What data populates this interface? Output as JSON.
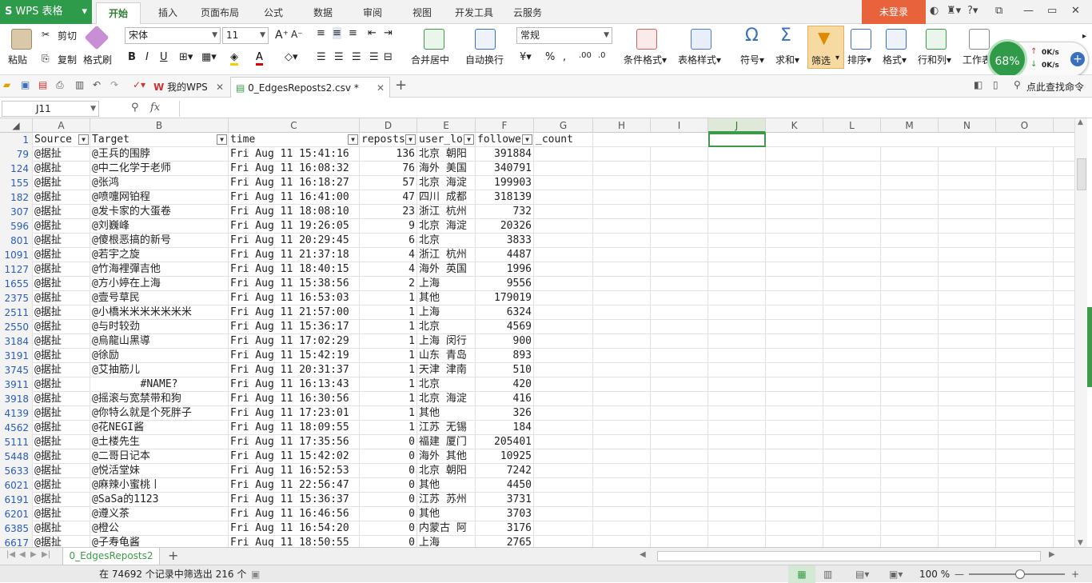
{
  "app": {
    "name": "WPS 表格"
  },
  "menu_tabs": [
    "开始",
    "插入",
    "页面布局",
    "公式",
    "数据",
    "审阅",
    "视图",
    "开发工具",
    "云服务"
  ],
  "login": "未登录",
  "ribbon": {
    "paste": "粘贴",
    "cut": "剪切",
    "copy": "复制",
    "format_painter": "格式刷",
    "font_name": "宋体",
    "font_size": "11",
    "merge": "合并居中",
    "wrap": "自动换行",
    "number_format": "常规",
    "cond_format": "条件格式",
    "table_style": "表格样式",
    "symbol": "符号",
    "sum": "求和",
    "filter": "筛选",
    "sort": "排序",
    "format": "格式",
    "rowcol": "行和列",
    "worksheet": "工作表"
  },
  "net_widget": {
    "percent": "68%",
    "up": "0K/s",
    "down": "0K/s"
  },
  "doc_tabs": {
    "mywps": "我的WPS",
    "file": "0_EdgesReposts2.csv *",
    "find_cmd": "点此查找命令"
  },
  "formula": {
    "cell_ref": "J11",
    "fx": "fx",
    "content": ""
  },
  "columns": [
    "A",
    "B",
    "C",
    "D",
    "E",
    "F",
    "G",
    "H",
    "I",
    "J",
    "K",
    "L",
    "M",
    "N",
    "O"
  ],
  "header_row": {
    "num": "1",
    "a": "Source",
    "b": "Target",
    "c": "time",
    "d": "reposts",
    "e": "user_lo",
    "f": "followe",
    "g": "_count"
  },
  "rows": [
    {
      "n": "79",
      "a": "@据扯",
      "b": "@王兵的围脖",
      "c": "Fri Aug 11 15:41:16",
      "d": "136",
      "e": "北京 朝阳",
      "f": "391884"
    },
    {
      "n": "124",
      "a": "@据扯",
      "b": "@中二化学于老师",
      "c": "Fri Aug 11 16:08:32",
      "d": "76",
      "e": "海外 美国",
      "f": "340791"
    },
    {
      "n": "155",
      "a": "@据扯",
      "b": "@张鸿",
      "c": "Fri Aug 11 16:18:27",
      "d": "57",
      "e": "北京 海淀",
      "f": "199903"
    },
    {
      "n": "182",
      "a": "@据扯",
      "b": "@喷嚏网铂程",
      "c": "Fri Aug 11 16:41:00",
      "d": "47",
      "e": "四川 成都",
      "f": "318139"
    },
    {
      "n": "307",
      "a": "@据扯",
      "b": "@发卡家的大蛋卷",
      "c": "Fri Aug 11 18:08:10",
      "d": "23",
      "e": "浙江 杭州",
      "f": "732"
    },
    {
      "n": "596",
      "a": "@据扯",
      "b": "@刘巍峰",
      "c": "Fri Aug 11 19:26:05",
      "d": "9",
      "e": "北京 海淀",
      "f": "20326"
    },
    {
      "n": "801",
      "a": "@据扯",
      "b": "@傻根恶搞的新号",
      "c": "Fri Aug 11 20:29:45",
      "d": "6",
      "e": "北京",
      "f": "3833"
    },
    {
      "n": "1091",
      "a": "@据扯",
      "b": "@若宇之旋",
      "c": "Fri Aug 11 21:37:18",
      "d": "4",
      "e": "浙江 杭州",
      "f": "4487"
    },
    {
      "n": "1127",
      "a": "@据扯",
      "b": "@竹海裡彈吉他",
      "c": "Fri Aug 11 18:40:15",
      "d": "4",
      "e": "海外 英国",
      "f": "1996"
    },
    {
      "n": "1655",
      "a": "@据扯",
      "b": "@方小婷在上海",
      "c": "Fri Aug 11 15:38:56",
      "d": "2",
      "e": "上海",
      "f": "9556"
    },
    {
      "n": "2375",
      "a": "@据扯",
      "b": "@壹号草民",
      "c": "Fri Aug 11 16:53:03",
      "d": "1",
      "e": "其他",
      "f": "179019"
    },
    {
      "n": "2511",
      "a": "@据扯",
      "b": "@小橋米米米米米米米",
      "c": "Fri Aug 11 21:57:00",
      "d": "1",
      "e": "上海",
      "f": "6324"
    },
    {
      "n": "2550",
      "a": "@据扯",
      "b": "@与时较劲",
      "c": "Fri Aug 11 15:36:17",
      "d": "1",
      "e": "北京",
      "f": "4569"
    },
    {
      "n": "3184",
      "a": "@据扯",
      "b": "@烏龍山黑導",
      "c": "Fri Aug 11 17:02:29",
      "d": "1",
      "e": "上海 闵行",
      "f": "900"
    },
    {
      "n": "3191",
      "a": "@据扯",
      "b": "@徐励",
      "c": "Fri Aug 11 15:42:19",
      "d": "1",
      "e": "山东 青岛",
      "f": "893"
    },
    {
      "n": "3745",
      "a": "@据扯",
      "b": "@艾抽筋儿",
      "c": "Fri Aug 11 20:31:37",
      "d": "1",
      "e": "天津 津南",
      "f": "510"
    },
    {
      "n": "3911",
      "a": "@据扯",
      "b": "#NAME?",
      "c": "Fri Aug 11 16:13:43",
      "d": "1",
      "e": "北京",
      "f": "420"
    },
    {
      "n": "3918",
      "a": "@据扯",
      "b": "@摇滚与宽禁带和狗",
      "c": "Fri Aug 11 16:30:56",
      "d": "1",
      "e": "北京 海淀",
      "f": "416"
    },
    {
      "n": "4139",
      "a": "@据扯",
      "b": "@你特么就是个死胖子",
      "c": "Fri Aug 11 17:23:01",
      "d": "1",
      "e": "其他",
      "f": "326"
    },
    {
      "n": "4562",
      "a": "@据扯",
      "b": "@花NEGI酱",
      "c": "Fri Aug 11 18:09:55",
      "d": "1",
      "e": "江苏 无锡",
      "f": "184"
    },
    {
      "n": "5111",
      "a": "@据扯",
      "b": "@土楼先生",
      "c": "Fri Aug 11 17:35:56",
      "d": "0",
      "e": "福建 厦门",
      "f": "205401"
    },
    {
      "n": "5448",
      "a": "@据扯",
      "b": "@二哥日记本",
      "c": "Fri Aug 11 15:42:02",
      "d": "0",
      "e": "海外 其他",
      "f": "10925"
    },
    {
      "n": "5633",
      "a": "@据扯",
      "b": "@悦活堂妹",
      "c": "Fri Aug 11 16:52:53",
      "d": "0",
      "e": "北京 朝阳",
      "f": "7242"
    },
    {
      "n": "6021",
      "a": "@据扯",
      "b": "@麻辣小蜜桃丨",
      "c": "Fri Aug 11 22:56:47",
      "d": "0",
      "e": "其他",
      "f": "4450"
    },
    {
      "n": "6191",
      "a": "@据扯",
      "b": "@SaSa的1123",
      "c": "Fri Aug 11 15:36:37",
      "d": "0",
      "e": "江苏 苏州",
      "f": "3731"
    },
    {
      "n": "6201",
      "a": "@据扯",
      "b": "@遵义茶",
      "c": "Fri Aug 11 16:46:56",
      "d": "0",
      "e": "其他",
      "f": "3703"
    },
    {
      "n": "6385",
      "a": "@据扯",
      "b": "@橙公",
      "c": "Fri Aug 11 16:54:20",
      "d": "0",
      "e": "内蒙古 阿",
      "f": "3176"
    },
    {
      "n": "6617",
      "a": "@据扯",
      "b": "@子寿龟酱",
      "c": "Fri Aug 11 18:50:55",
      "d": "0",
      "e": "上海",
      "f": "2765"
    }
  ],
  "sheet": {
    "name": "0_EdgesReposts2",
    "add": "+"
  },
  "status": {
    "text": "在 74692 个记录中筛选出 216 个",
    "zoom": "100 %"
  },
  "colors": {
    "accent": "#3c9a48",
    "app_green": "#2e9b4a",
    "login_orange": "#e8623c",
    "rownum_blue": "#2a5cb8"
  }
}
